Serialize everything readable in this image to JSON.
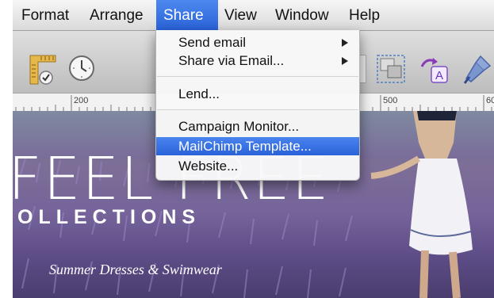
{
  "menubar": {
    "items": [
      {
        "label": "Format"
      },
      {
        "label": "Arrange"
      },
      {
        "label": "Share"
      },
      {
        "label": "View"
      },
      {
        "label": "Window"
      },
      {
        "label": "Help"
      }
    ],
    "active_item": "Share"
  },
  "toolbar": {
    "icons": [
      "ruler-check-icon",
      "clock-icon",
      "group-icon",
      "text-style-icon",
      "brush-icon"
    ]
  },
  "ruler": {
    "labels": [
      "200",
      "500",
      "60"
    ]
  },
  "share_menu": {
    "items": [
      {
        "label": "Send email",
        "submenu": true
      },
      {
        "label": "Share via Email...",
        "submenu": true
      },
      {
        "label": "Lend..."
      },
      {
        "label": "Campaign Monitor..."
      },
      {
        "label": "MailChimp Template...",
        "highlighted": true
      },
      {
        "label": "Website..."
      }
    ]
  },
  "canvas": {
    "headline": "FEEL FREE",
    "subheadline": "OLLECTIONS",
    "tagline": "Summer Dresses & Swimwear"
  },
  "colors": {
    "menu_highlight": "#2a63d8",
    "lavender": "#7d6f97"
  }
}
